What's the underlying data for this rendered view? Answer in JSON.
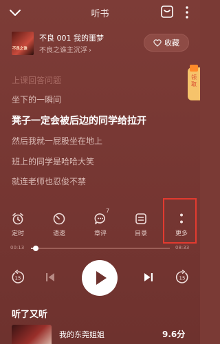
{
  "header": {
    "title": "听书"
  },
  "book": {
    "cover_text": "不良之谁",
    "title": "不良 001 我的噩梦",
    "author": "不良之谁主沉浮",
    "collect_label": "收藏"
  },
  "side_badge": {
    "label": "领取"
  },
  "lyrics": [
    {
      "text": "上课回答问题",
      "state": "faded"
    },
    {
      "text": "坐下的一瞬间",
      "state": "normal"
    },
    {
      "text": "凳子一定会被后边的同学给拉开",
      "state": "active"
    },
    {
      "text": "然后我就一屁股坐在地上",
      "state": "normal"
    },
    {
      "text": "班上的同学是哈哈大笑",
      "state": "normal"
    },
    {
      "text": "就连老师也忍俊不禁",
      "state": "normal"
    }
  ],
  "controls": [
    {
      "label": "定时",
      "icon": "alarm-clock-icon"
    },
    {
      "label": "语速",
      "icon": "speed-gauge-icon"
    },
    {
      "label": "章评",
      "icon": "comment-icon",
      "badge": "7"
    },
    {
      "label": "目录",
      "icon": "catalog-icon"
    },
    {
      "label": "更多",
      "icon": "more-vertical-icon"
    }
  ],
  "progress": {
    "elapsed": "00:13",
    "total": "08:33",
    "fraction": 0.025
  },
  "player": {
    "rewind": "15",
    "forward": "15"
  },
  "recommend": {
    "title": "听了又听",
    "items": [
      {
        "name": "我的东莞姐姐",
        "score": "9.6分"
      }
    ]
  },
  "colors": {
    "background": "#7a3a35",
    "highlight": "#e33a2f",
    "badge": "#f6c36b"
  }
}
